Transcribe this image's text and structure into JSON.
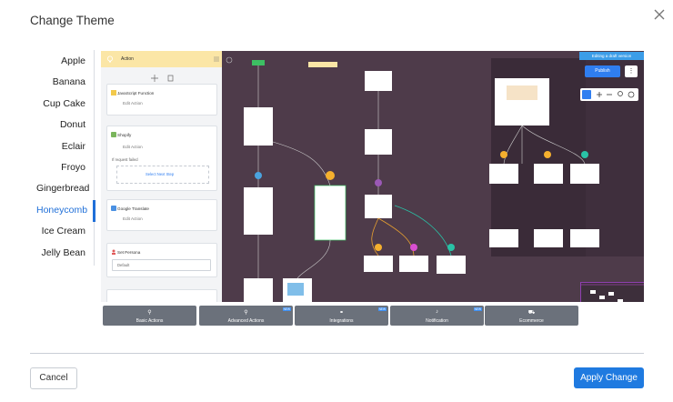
{
  "dialog": {
    "title": "Change Theme",
    "close_icon": "close-icon"
  },
  "themes": [
    {
      "label": "Apple"
    },
    {
      "label": "Banana"
    },
    {
      "label": "Cup Cake"
    },
    {
      "label": "Donut"
    },
    {
      "label": "Eclair"
    },
    {
      "label": "Froyo"
    },
    {
      "label": "Gingerbread"
    },
    {
      "label": "Honeycomb",
      "selected": true
    },
    {
      "label": "Ice Cream"
    },
    {
      "label": "Jelly Bean"
    }
  ],
  "preview": {
    "left_panel": {
      "header": "Action",
      "cards": [
        {
          "title": "JavaScript Function",
          "sub": "Edit Action"
        },
        {
          "title": "Shopify",
          "sub": "Edit Action",
          "extra": "If request failed",
          "link": "Select Next Step"
        },
        {
          "title": "Google Translate",
          "sub": "Edit Action"
        },
        {
          "title": "Set Persona",
          "select": "Default"
        }
      ]
    },
    "toolbar": {
      "draft_label": "Editing a draft version",
      "publish_label": "Publish"
    },
    "bottom_tabs": [
      {
        "label": "Basic Actions",
        "icon": "person-icon",
        "new": false
      },
      {
        "label": "Advanced Actions",
        "icon": "person-icon",
        "new": true
      },
      {
        "label": "Integrations",
        "icon": "link-icon",
        "new": true
      },
      {
        "label": "Notification",
        "icon": "bell-icon",
        "new": true
      },
      {
        "label": "Ecommerce",
        "icon": "cart-icon",
        "new": false
      }
    ],
    "new_badge": "NEW"
  },
  "footer": {
    "cancel_label": "Cancel",
    "apply_label": "Apply Change"
  },
  "colors": {
    "accent": "#1f7ae0",
    "canvas": "#4e3b4a",
    "panel_header": "#fbe6a6"
  }
}
